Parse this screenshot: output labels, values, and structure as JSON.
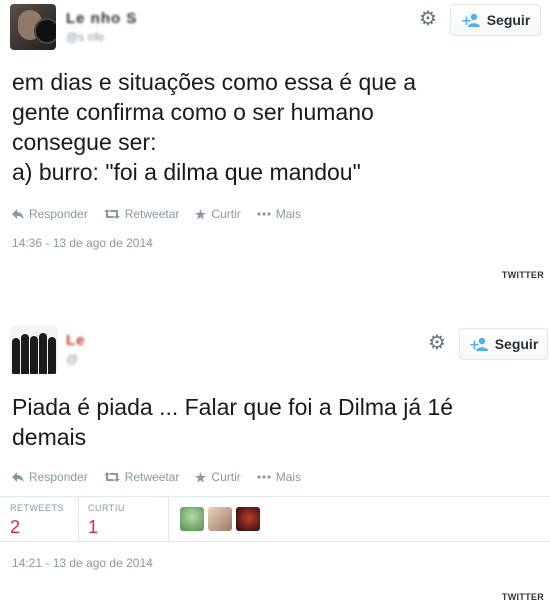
{
  "tweets": [
    {
      "name": "Le nho S",
      "handle": "@s nfe",
      "follow_label": "Seguir",
      "text": "em dias e situações como essa é que a\ngente confirma como o ser humano\nconsegue ser:\na) burro: \"foi a dilma que mandou\"",
      "actions": [
        "Responder",
        "Retweetar",
        "Curtir",
        "Mais"
      ],
      "timestamp": "14:36 - 13 de ago de 2014",
      "credit": "TWITTER"
    },
    {
      "name": "Le",
      "handle": "@",
      "follow_label": "Seguir",
      "text": "Piada é piada ... Falar que foi a Dilma já 1é\ndemais",
      "actions": [
        "Responder",
        "Retweetar",
        "Curtir",
        "Mais"
      ],
      "stats": {
        "retweets_label": "RETWEETS",
        "retweets_value": "2",
        "likes_label": "CURTIU",
        "likes_value": "1"
      },
      "timestamp": "14:21 - 13 de ago de 2014",
      "credit": "TWITTER"
    }
  ],
  "icons": {
    "reply": "reply-icon",
    "retweet": "retweet-icon",
    "like": "star-icon",
    "more": "more-dots-icon",
    "gear": "gear-icon",
    "follow": "add-user-icon"
  },
  "colors": {
    "follow_icon": "#55acee",
    "stat_value": "#e0245e",
    "muted": "#8899a6"
  }
}
